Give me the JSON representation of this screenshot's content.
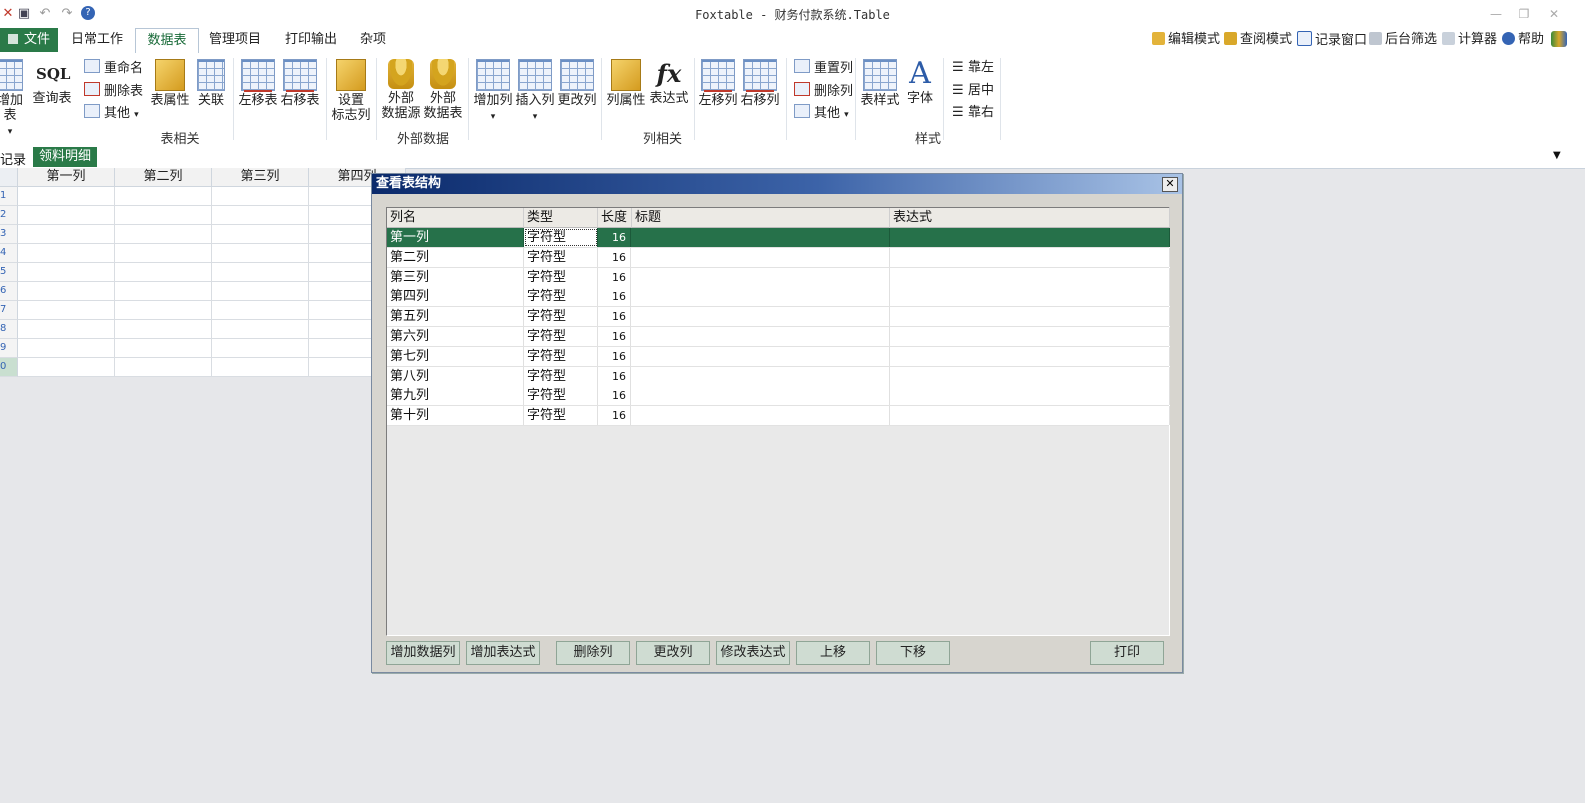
{
  "window": {
    "title": "Foxtable - 财务付款系统.Table"
  },
  "tabs": [
    "文件",
    "日常工作",
    "数据表",
    "管理项目",
    "打印输出",
    "杂项"
  ],
  "right_tools": [
    "编辑模式",
    "查阅模式",
    "记录窗口",
    "后台筛选",
    "计算器",
    "帮助"
  ],
  "ribbon": {
    "add_table": "增加表",
    "sql_icon": "SQL",
    "query_table": "查询表",
    "rename": "重命名",
    "delete_table": "删除表",
    "other1": "其他",
    "table_props": "表属性",
    "relation": "关联",
    "move_table_left": "左移表",
    "move_table_right": "右移表",
    "set_flag_col_1": "设置",
    "set_flag_col_2": "标志列",
    "group_table": "表相关",
    "ext_source_1": "外部",
    "ext_source_2": "数据源",
    "ext_table_1": "外部",
    "ext_table_2": "数据表",
    "group_external": "外部数据",
    "add_col": "增加列",
    "insert_col": "插入列",
    "change_col": "更改列",
    "col_props": "列属性",
    "fx_icon": "fx",
    "expression": "表达式",
    "move_col_left": "左移列",
    "move_col_right": "右移列",
    "reset_col": "重置列",
    "delete_col": "删除列",
    "other2": "其他",
    "group_col": "列相关",
    "table_style": "表样式",
    "font_icon": "A",
    "font": "字体",
    "align_left": "靠左",
    "align_center": "居中",
    "align_right": "靠右",
    "group_style": "样式"
  },
  "sheetbar": {
    "records_label": "记录",
    "active_sheet": "领料明细"
  },
  "grid": {
    "columns": [
      "第一列",
      "第二列",
      "第三列",
      "第四列"
    ],
    "row_numbers": [
      "1",
      "2",
      "3",
      "4",
      "5",
      "6",
      "7",
      "8",
      "9",
      "0"
    ]
  },
  "dialog": {
    "title": "查看表结构",
    "close": "✕",
    "headers": {
      "name": "列名",
      "type": "类型",
      "length": "长度",
      "caption": "标题",
      "expression": "表达式"
    },
    "rows": [
      {
        "name": "第一列",
        "type": "字符型",
        "length": "16",
        "caption": "",
        "expression": ""
      },
      {
        "name": "第二列",
        "type": "字符型",
        "length": "16",
        "caption": "",
        "expression": ""
      },
      {
        "name": "第三列",
        "type": "字符型",
        "length": "16",
        "caption": "",
        "expression": ""
      },
      {
        "name": "第四列",
        "type": "字符型",
        "length": "16",
        "caption": "",
        "expression": ""
      },
      {
        "name": "第五列",
        "type": "字符型",
        "length": "16",
        "caption": "",
        "expression": ""
      },
      {
        "name": "第六列",
        "type": "字符型",
        "length": "16",
        "caption": "",
        "expression": ""
      },
      {
        "name": "第七列",
        "type": "字符型",
        "length": "16",
        "caption": "",
        "expression": ""
      },
      {
        "name": "第八列",
        "type": "字符型",
        "length": "16",
        "caption": "",
        "expression": ""
      },
      {
        "name": "第九列",
        "type": "字符型",
        "length": "16",
        "caption": "",
        "expression": ""
      },
      {
        "name": "第十列",
        "type": "字符型",
        "length": "16",
        "caption": "",
        "expression": ""
      }
    ],
    "buttons": [
      "增加数据列",
      "增加表达式",
      "删除列",
      "更改列",
      "修改表达式",
      "上移",
      "下移"
    ],
    "print_button": "打印"
  }
}
